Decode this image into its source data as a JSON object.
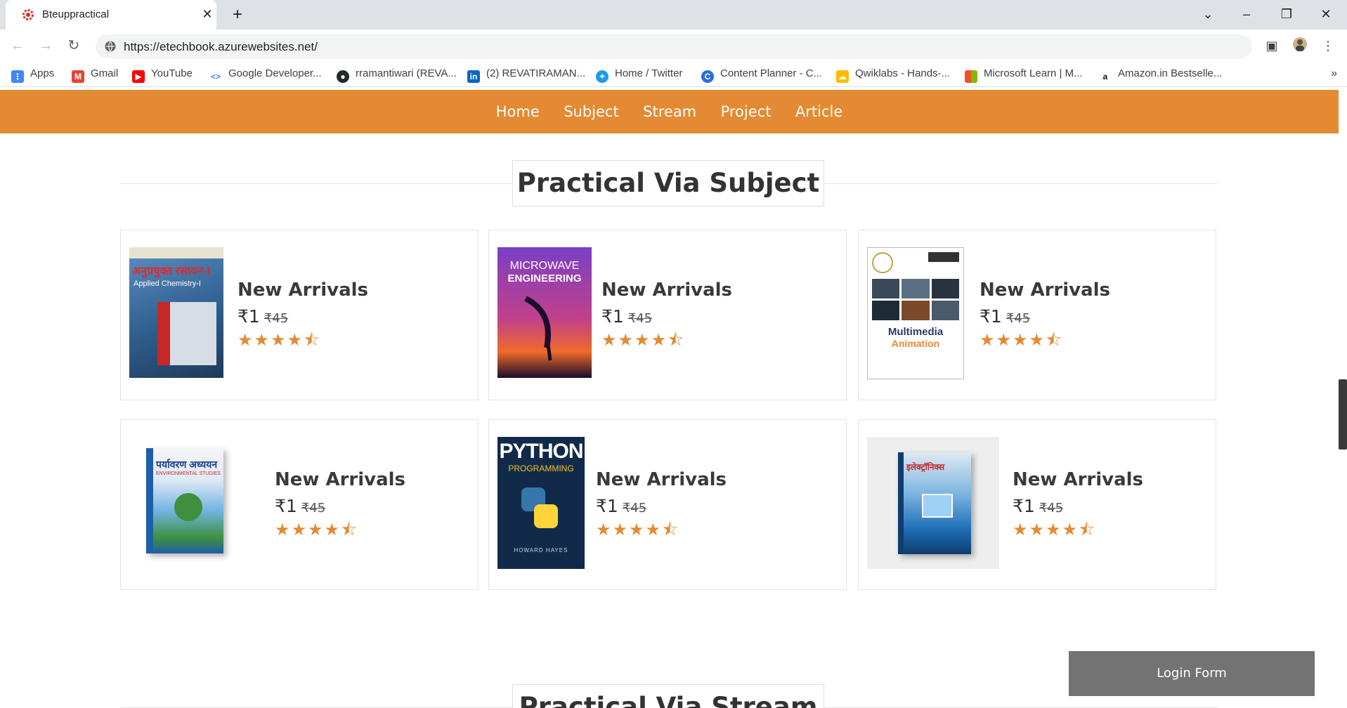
{
  "browser": {
    "tab_title": "Bteuppractical",
    "url": "https://etechbook.azurewebsites.net/",
    "bookmarks": [
      {
        "label": "Apps",
        "icon": "apps-grid-icon",
        "color": "#4285f4"
      },
      {
        "label": "Gmail",
        "icon": "gmail-icon",
        "color": "#ea4335"
      },
      {
        "label": "YouTube",
        "icon": "youtube-icon",
        "color": "#ff0000"
      },
      {
        "label": "Google Developer...",
        "icon": "google-developers-icon",
        "color": "#4285f4"
      },
      {
        "label": "rramantiwari (REVA...",
        "icon": "github-icon",
        "color": "#24292e"
      },
      {
        "label": "(2) REVATIRAMAN...",
        "icon": "linkedin-icon",
        "color": "#0a66c2"
      },
      {
        "label": "Home / Twitter",
        "icon": "twitter-icon",
        "color": "#1d9bf0"
      },
      {
        "label": "Content Planner - C...",
        "icon": "content-planner-icon",
        "color": "#2b6de0"
      },
      {
        "label": "Qwiklabs - Hands-...",
        "icon": "google-cloud-icon",
        "color": "#4285f4"
      },
      {
        "label": "Microsoft Learn | M...",
        "icon": "microsoft-icon",
        "color": "#f25022"
      },
      {
        "label": "Amazon.in Bestselle...",
        "icon": "amazon-icon",
        "color": "#111111"
      }
    ],
    "bookmarks_more": "»"
  },
  "site": {
    "accent": "#e48a32",
    "nav": [
      "Home",
      "Subject",
      "Stream",
      "Project",
      "Article"
    ],
    "section1_title": "Practical Via Subject",
    "section2_title": "Practical Via Stream",
    "login_label": "Login Form"
  },
  "products": [
    {
      "name": "New Arrivals",
      "price": "₹1",
      "old_price": "₹45",
      "rating": 4.5,
      "stars": "★★★★⯪",
      "cover_alt": "अनुप्रयुक्त रसायन-I Applied Chemistry-I",
      "cover_text": "अनुप्रयुक्त रसायन-I",
      "cover_sub": "Applied Chemistry-I"
    },
    {
      "name": "New Arrivals",
      "price": "₹1",
      "old_price": "₹45",
      "rating": 4.5,
      "stars": "★★★★⯪",
      "cover_text": "MICROWAVE",
      "cover_sub": "ENGINEERING"
    },
    {
      "name": "New Arrivals",
      "price": "₹1",
      "old_price": "₹45",
      "rating": 4.5,
      "stars": "★★★★⯪",
      "cover_text": "Multimedia",
      "cover_sub": "Animation"
    },
    {
      "name": "New Arrivals",
      "price": "₹1",
      "old_price": "₹45",
      "rating": 4.5,
      "stars": "★★★★⯪",
      "cover_text": "पर्यावरण अध्ययन",
      "cover_sub": "ENVIRONMENTAL STUDIES"
    },
    {
      "name": "New Arrivals",
      "price": "₹1",
      "old_price": "₹45",
      "rating": 4.5,
      "stars": "★★★★⯪",
      "cover_text": "PYTHON",
      "cover_sub": "PROGRAMMING",
      "cover_author": "HOWARD HAYES"
    },
    {
      "name": "New Arrivals",
      "price": "₹1",
      "old_price": "₹45",
      "rating": 4.5,
      "stars": "★★★★⯪",
      "cover_text": "इलेक्ट्रॉनिक्स",
      "cover_sub": ""
    }
  ]
}
